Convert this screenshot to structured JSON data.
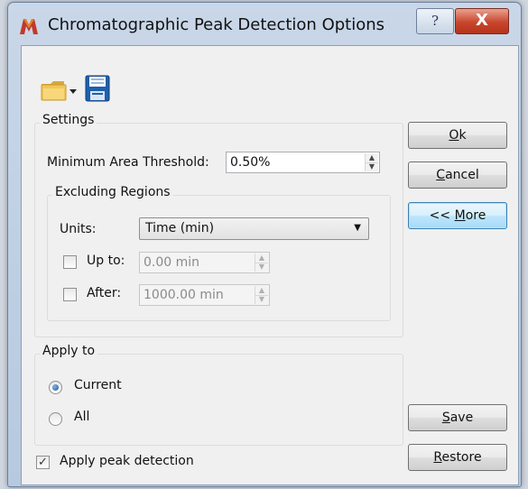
{
  "window": {
    "title": "Chromatographic Peak Detection Options",
    "help_glyph": "?",
    "close_glyph": "X"
  },
  "toolbar": {
    "open_icon": "folder-icon",
    "save_icon": "floppy-disk-icon"
  },
  "settings": {
    "legend": "Settings",
    "min_area_label": "Minimum Area Threshold:",
    "min_area_value": "0.50%",
    "excluding": {
      "legend": "Excluding Regions",
      "units_label": "Units:",
      "units_value": "Time (min)",
      "up_to_label": "Up to:",
      "up_to_checked": false,
      "up_to_value": "0.00 min",
      "after_label": "After:",
      "after_checked": false,
      "after_value": "1000.00 min"
    }
  },
  "apply_to": {
    "legend": "Apply to",
    "options": [
      {
        "label": "Current",
        "selected": true
      },
      {
        "label": "All",
        "selected": false
      }
    ]
  },
  "apply_peak_detection": {
    "label": "Apply peak detection",
    "checked": true
  },
  "buttons": {
    "ok": {
      "mnemonic": "O",
      "rest": "k"
    },
    "cancel": {
      "mnemonic": "C",
      "rest": "ancel"
    },
    "more": {
      "prefix": "<< ",
      "mnemonic": "M",
      "rest": "ore"
    },
    "save": {
      "mnemonic": "S",
      "rest": "ave"
    },
    "restore": {
      "mnemonic": "R",
      "rest": "estore"
    }
  },
  "colors": {
    "title_bar": "#c9d7e8",
    "close_button": "#c9462d",
    "dialog_bg": "#f0f0f0",
    "focus_button": "#bee6fd"
  }
}
